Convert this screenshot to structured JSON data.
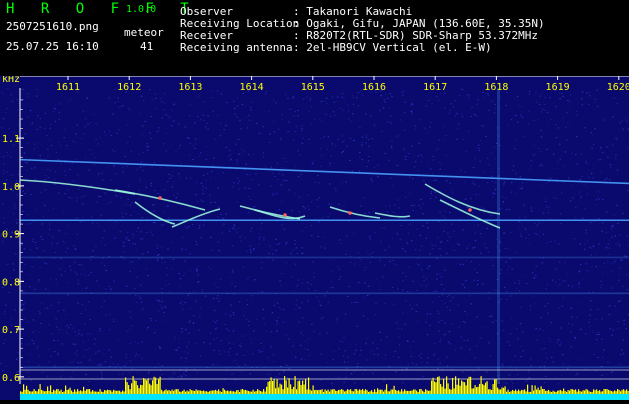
{
  "app": {
    "name": "H R O F F T",
    "version": "1.0.0",
    "filename": "2507251610.png",
    "datetime": "25.07.25 16:10",
    "counter_label": "meteor",
    "counter_value": "41"
  },
  "info": {
    "observer_label": "Observer",
    "observer_value": ": Takanori Kawachi",
    "location_label": "Receiving Location",
    "location_value": ": Ogaki, Gifu, JAPAN (136.60E, 35.35N)",
    "receiver_label": "Receiver",
    "receiver_value": ": R820T2(RTL-SDR) SDR-Sharp 53.372MHz",
    "antenna_label": "Receiving antenna",
    "antenna_value": ": 2el-HB9CV Vertical (el. E-W)"
  },
  "spectrogram": {
    "y_unit": "kHz",
    "y_ticks": [
      "1.1",
      "1.0",
      "0.9",
      "0.8",
      "0.7",
      "0.6"
    ],
    "y_tick_values": [
      1.1,
      1.0,
      0.9,
      0.8,
      0.7,
      0.6
    ],
    "y_range": [
      0.585,
      1.205
    ],
    "x_ticks": [
      "1611",
      "1612",
      "1613",
      "1614",
      "1615",
      "1616",
      "1617",
      "1618",
      "1619",
      "1620"
    ],
    "colors": {
      "background": "#0a0a6e",
      "noise": "#2b3bd0",
      "carrier": "#4aa0ff",
      "echo": "#9fffe0",
      "echo_hot": "#ff6060",
      "baseline": "#00e5ff",
      "peak": "#ffff00",
      "grid": "#ffffff",
      "axis_text": "#ffff00"
    }
  }
}
